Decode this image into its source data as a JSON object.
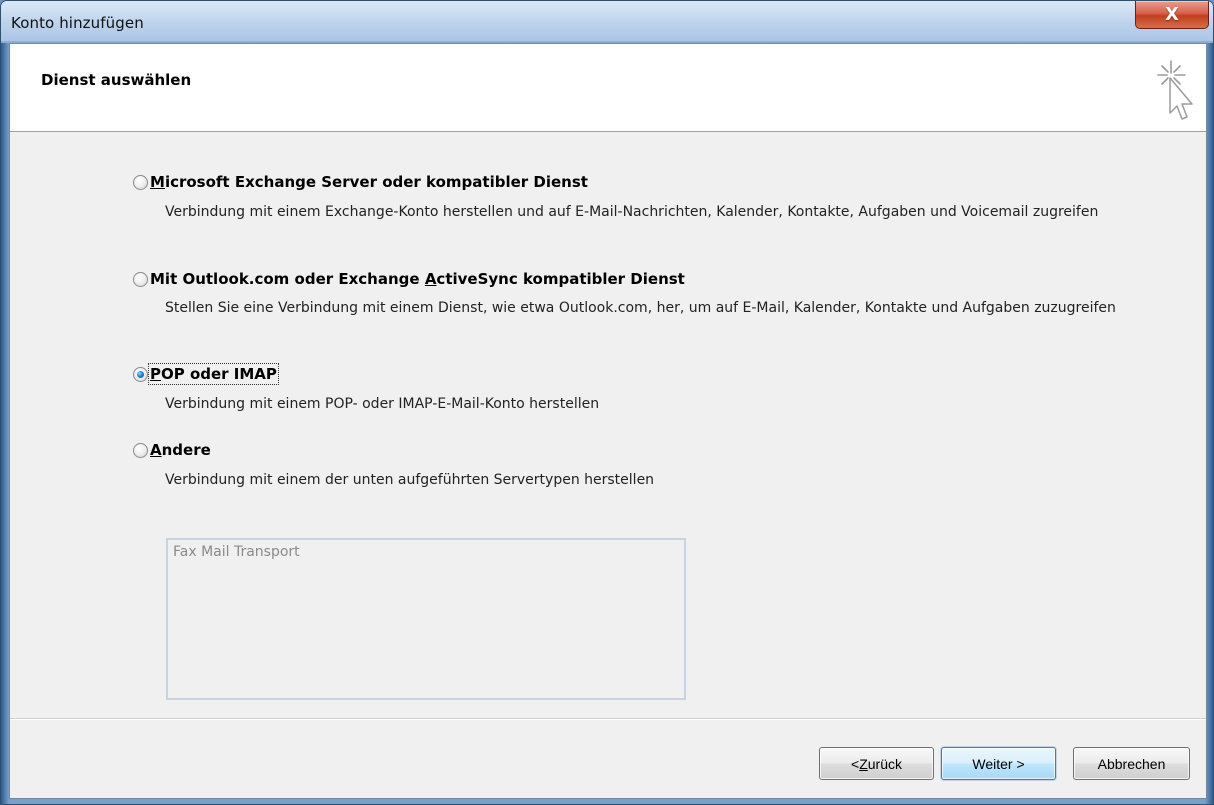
{
  "window": {
    "title": "Konto hinzufügen",
    "close_glyph": "X"
  },
  "header": {
    "title": "Dienst auswählen",
    "icon": "wizard-cursor-icon"
  },
  "options": [
    {
      "label_prefix": "",
      "label_mnemonic": "M",
      "label_suffix": "icrosoft Exchange Server oder kompatibler Dienst",
      "description": "Verbindung mit einem Exchange-Konto herstellen und auf E-Mail-Nachrichten, Kalender, Kontakte, Aufgaben und Voicemail zugreifen",
      "checked": false
    },
    {
      "label_prefix": "Mit Outlook.com oder Exchange ",
      "label_mnemonic": "A",
      "label_suffix": "ctiveSync kompatibler Dienst",
      "description": "Stellen Sie eine Verbindung mit einem Dienst, wie etwa Outlook.com, her, um auf E-Mail, Kalender, Kontakte und Aufgaben zuzugreifen",
      "checked": false
    },
    {
      "label_prefix": "",
      "label_mnemonic": "P",
      "label_suffix": "OP oder IMAP",
      "description": "Verbindung mit einem POP- oder IMAP-E-Mail-Konto herstellen",
      "checked": true
    },
    {
      "label_prefix": "",
      "label_mnemonic": "A",
      "label_suffix": "ndere",
      "description": "Verbindung mit einem der unten aufgeführten Servertypen herstellen",
      "checked": false
    }
  ],
  "server_types": {
    "items": [
      "Fax Mail Transport"
    ]
  },
  "buttons": {
    "back_prefix": "< ",
    "back_mnemonic": "Z",
    "back_suffix": "urück",
    "next_label": "Weiter >",
    "cancel_label": "Abbrechen"
  },
  "colors": {
    "accent": "#3c7fb1",
    "window_frame": "#7a9fc9",
    "close_button": "#c23e22"
  }
}
